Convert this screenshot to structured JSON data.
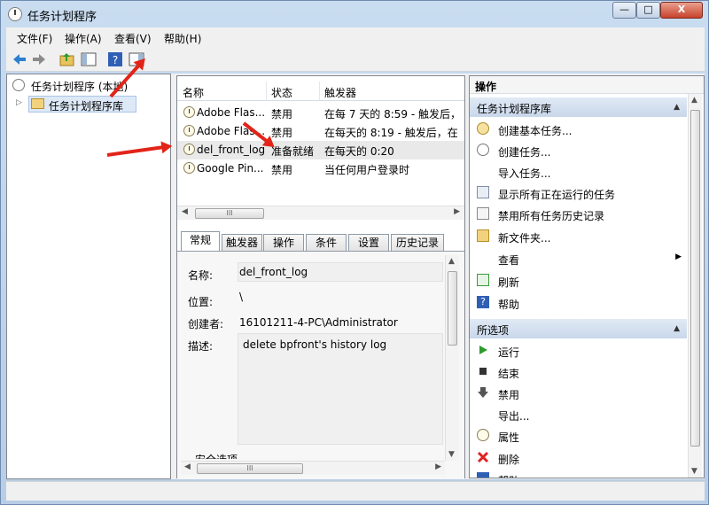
{
  "window": {
    "title": "任务计划程序",
    "controls": {
      "minimize": "—",
      "maximize": "□",
      "close": "X"
    }
  },
  "menubar": {
    "items": [
      "文件(F)",
      "操作(A)",
      "查看(V)",
      "帮助(H)"
    ]
  },
  "tree": {
    "root": "任务计划程序 (本地)",
    "child": "任务计划程序库",
    "expander": "▷"
  },
  "task_list": {
    "columns": [
      "名称",
      "状态",
      "触发器"
    ],
    "rows": [
      {
        "name": "Adobe Flas...",
        "status": "禁用",
        "trigger": "在每 7 天的 8:59 - 触发后，"
      },
      {
        "name": "Adobe Flas...",
        "status": "禁用",
        "trigger": "在每天的 8:19 - 触发后，在"
      },
      {
        "name": "del_front_log",
        "status": "准备就绪",
        "trigger": "在每天的 0:20"
      },
      {
        "name": "Google Pin...",
        "status": "禁用",
        "trigger": "当任何用户登录时"
      }
    ],
    "scroll_thumb": "III"
  },
  "tabs": [
    "常规",
    "触发器",
    "操作",
    "条件",
    "设置",
    "历史记录"
  ],
  "details": {
    "name_label": "名称:",
    "name_value": "del_front_log",
    "location_label": "位置:",
    "location_value": "\\",
    "author_label": "创建者:",
    "author_value": "16101211-4-PC\\Administrator",
    "desc_label": "描述:",
    "desc_value": "delete bpfront's history log",
    "security_label": "安全选项",
    "scroll_thumb": "III"
  },
  "actions": {
    "header": "操作",
    "library_section": "任务计划程序库",
    "library_items": [
      "创建基本任务...",
      "创建任务...",
      "导入任务...",
      "显示所有正在运行的任务",
      "禁用所有任务历史记录",
      "新文件夹...",
      "查看",
      "刷新",
      "帮助"
    ],
    "selected_section": "所选项",
    "selected_items": [
      "运行",
      "结束",
      "禁用",
      "导出...",
      "属性",
      "删除",
      "帮助"
    ],
    "collapse_glyph": "▲",
    "submenu_glyph": "▶"
  },
  "colors": {
    "annotation_arrow": "#e22418",
    "section_header": "#c8d7ea",
    "selected_row": "#e9e9e9"
  }
}
